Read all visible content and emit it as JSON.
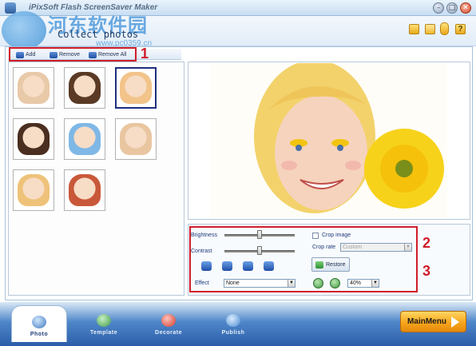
{
  "window": {
    "title": "iPixSoft Flash ScreenSaver Maker",
    "minimize_glyph": "–",
    "maximize_glyph": "□",
    "close_glyph": "✕"
  },
  "watermark": {
    "title": "河东软件园",
    "subtitle": "Collect photos",
    "url": "www.pc0359.cn"
  },
  "header_icons": {
    "folder_icon": "folder-icon",
    "save_icon": "save-icon",
    "info_icon": "info-icon",
    "help_label": "?"
  },
  "photo_toolbar": {
    "add_label": "Add",
    "remove_label": "Remove",
    "remove_all_label": "Remove All"
  },
  "annotations": {
    "n1": "1",
    "n2": "2",
    "n3": "3"
  },
  "thumbnails": [
    {
      "id": "child-1",
      "color": "#e8c9a8"
    },
    {
      "id": "child-2",
      "color": "#5a3a25"
    },
    {
      "id": "child-3",
      "color": "#f2c48a",
      "selected": true
    },
    {
      "id": "child-4",
      "color": "#4a2e1f"
    },
    {
      "id": "child-5",
      "color": "#7fb8e6"
    },
    {
      "id": "child-6",
      "color": "#e9c6a0"
    },
    {
      "id": "child-7",
      "color": "#efc27a"
    },
    {
      "id": "child-8",
      "color": "#c9583a"
    }
  ],
  "controls": {
    "brightness_label": "Brightness",
    "contrast_label": "Contrast",
    "brightness_value": 0.5,
    "contrast_value": 0.5,
    "crop_image_label": "Crop image",
    "crop_image_checked": false,
    "crop_rate_label": "Crop rate",
    "crop_rate_value": "Custom",
    "effect_label": "Effect",
    "effect_value": "None",
    "restore_label": "Restore",
    "zoom_value": "40%"
  },
  "tabs": [
    {
      "label": "Photo",
      "active": true
    },
    {
      "label": "Template",
      "active": false
    },
    {
      "label": "Decorate",
      "active": false
    },
    {
      "label": "Publish",
      "active": false
    }
  ],
  "main_menu_label": "MainMenu",
  "colors": {
    "accent_red": "#d01e2a",
    "brand_blue": "#2b5ea8",
    "orange_button": "#f7a51c"
  }
}
